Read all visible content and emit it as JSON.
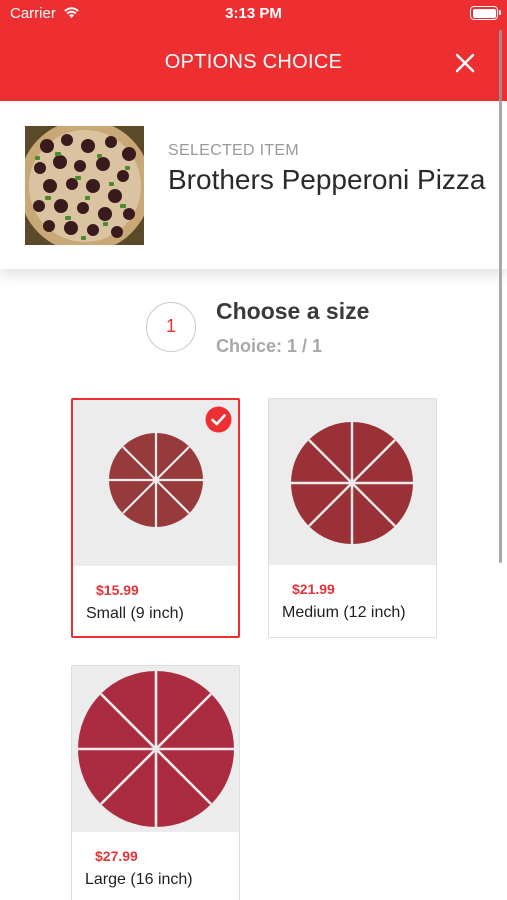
{
  "status_bar": {
    "carrier": "Carrier",
    "time": "3:13 PM"
  },
  "nav": {
    "title": "OPTIONS CHOICE",
    "close_icon": "close-icon"
  },
  "selected_item": {
    "kicker": "SELECTED ITEM",
    "name": "Brothers Pepperoni Pizza",
    "image": "pepperoni-pizza-photo"
  },
  "step": {
    "number": "1",
    "title": "Choose a size",
    "subtitle": "Choice: 1 / 1"
  },
  "options": [
    {
      "price": "$15.99",
      "label": "Small (9 inch)",
      "selected": true,
      "color": "#963a3c"
    },
    {
      "price": "$21.99",
      "label": "Medium (12 inch)",
      "selected": false,
      "color": "#9a3137"
    },
    {
      "price": "$27.99",
      "label": "Large (16 inch)",
      "selected": false,
      "color": "#ab2b40"
    }
  ],
  "colors": {
    "accent": "#ee2f32",
    "price": "#e1343a"
  }
}
